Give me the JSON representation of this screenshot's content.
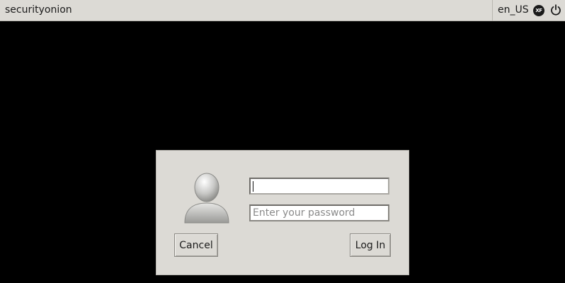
{
  "topbar": {
    "hostname": "securityonion",
    "locale": "en_US",
    "session_icon_text": "XF",
    "icons": {
      "session": "xfce-session-icon",
      "power": "power-icon"
    }
  },
  "login": {
    "avatar_icon": "user-avatar-icon",
    "username": {
      "value": "",
      "placeholder": ""
    },
    "password": {
      "value": "",
      "placeholder": "Enter your password"
    },
    "cancel_label": "Cancel",
    "login_label": "Log In"
  },
  "colors": {
    "background": "#000000",
    "panel": "#dcdad5",
    "border": "#b8b6b0"
  }
}
